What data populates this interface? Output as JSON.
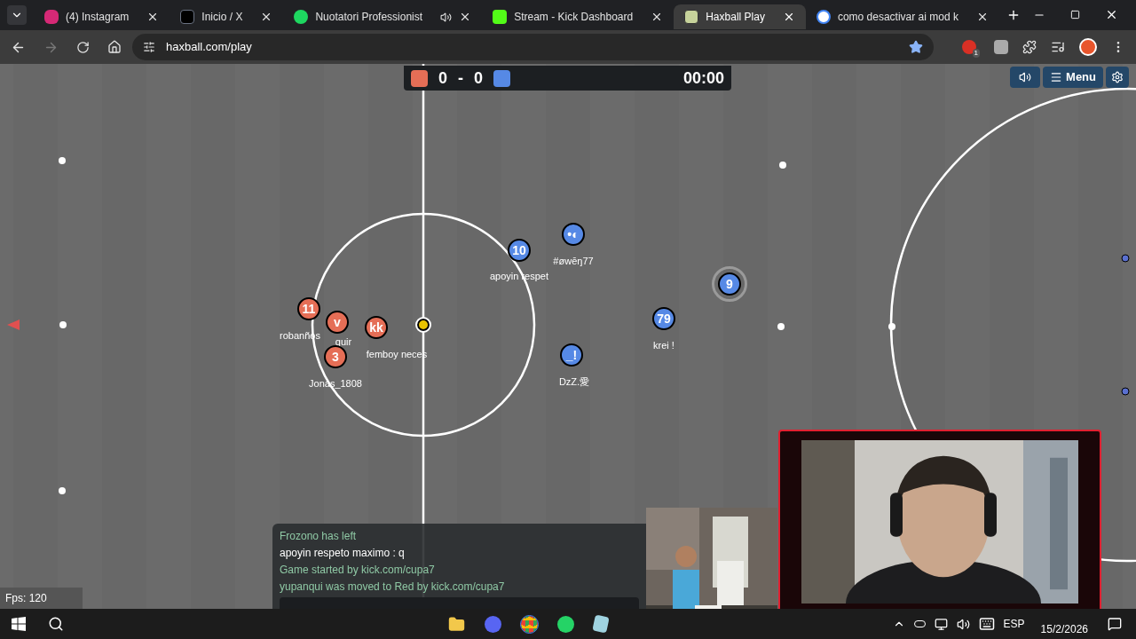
{
  "tabs": [
    {
      "title": "(4) Instagram",
      "selected": false,
      "audio": false
    },
    {
      "title": "Inicio / X",
      "selected": false,
      "audio": false
    },
    {
      "title": "Nuotatori Professionist",
      "selected": false,
      "audio": true
    },
    {
      "title": "Stream - Kick Dashboard",
      "selected": false,
      "audio": false
    },
    {
      "title": "Haxball Play",
      "selected": true,
      "audio": false
    },
    {
      "title": "como desactivar ai mod k",
      "selected": false,
      "audio": false
    }
  ],
  "address_bar": {
    "url": "haxball.com/play"
  },
  "extension_badge": "1",
  "scoreboard": {
    "red_score": "0",
    "separator": "-",
    "blue_score": "0",
    "time": "00:00"
  },
  "game_buttons": {
    "menu": "Menu"
  },
  "players": [
    {
      "kind": "red",
      "avatar": "11",
      "name": "robanños",
      "highlighted": false
    },
    {
      "kind": "red",
      "avatar": "v",
      "name": "quir",
      "highlighted": false
    },
    {
      "kind": "red",
      "avatar": "3",
      "name": "Jonas_1808",
      "highlighted": false
    },
    {
      "kind": "red",
      "avatar": "kk",
      "name": "femboy neces",
      "highlighted": false
    },
    {
      "kind": "blue",
      "avatar": "10",
      "name": "apoyin respet",
      "highlighted": false
    },
    {
      "kind": "blue",
      "avatar": "•◐",
      "name": "#øwēŋ77",
      "highlighted": false
    },
    {
      "kind": "blue",
      "avatar": "_!",
      "name": "DzZ.愛",
      "highlighted": false
    },
    {
      "kind": "blue",
      "avatar": "79",
      "name": "krei !",
      "highlighted": false
    },
    {
      "kind": "blue",
      "avatar": "9",
      "highlighted": true
    }
  ],
  "chat": [
    {
      "text": "Frozono has left",
      "kind": "notice"
    },
    {
      "text": "apoyin respeto maximo : q",
      "kind": "message"
    },
    {
      "text": "Game started by kick.com/cupa7",
      "kind": "notice"
    },
    {
      "text": "yupanqui was moved to Red by kick.com/cupa7",
      "kind": "notice"
    }
  ],
  "fps": "Fps: 120",
  "taskbar": {
    "language": "ESP",
    "date": "15/2/2026"
  }
}
